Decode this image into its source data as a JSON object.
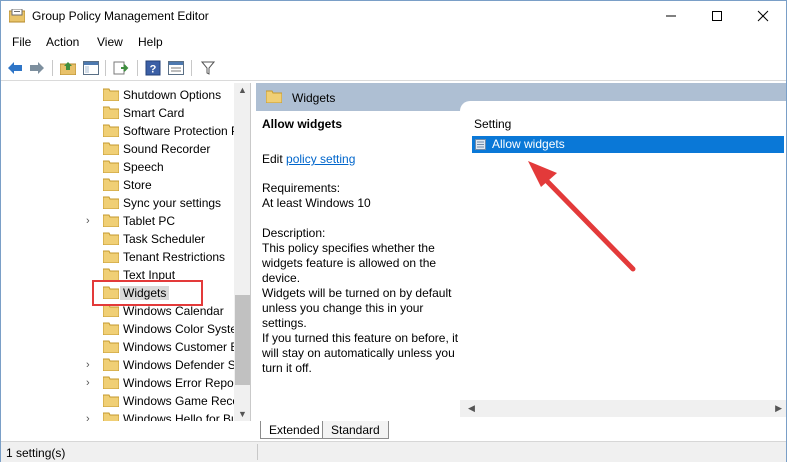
{
  "window": {
    "title": "Group Policy Management Editor",
    "controls": {
      "minimize": "—",
      "maximize": "☐",
      "close": "✕"
    }
  },
  "menu": {
    "items": [
      "File",
      "Action",
      "View",
      "Help"
    ]
  },
  "tree": {
    "items": [
      {
        "label": "Shutdown Options",
        "expandable": false
      },
      {
        "label": "Smart Card",
        "expandable": false
      },
      {
        "label": "Software Protection P",
        "expandable": false
      },
      {
        "label": "Sound Recorder",
        "expandable": false
      },
      {
        "label": "Speech",
        "expandable": false
      },
      {
        "label": "Store",
        "expandable": false
      },
      {
        "label": "Sync your settings",
        "expandable": false
      },
      {
        "label": "Tablet PC",
        "expandable": true
      },
      {
        "label": "Task Scheduler",
        "expandable": false
      },
      {
        "label": "Tenant Restrictions",
        "expandable": false
      },
      {
        "label": "Text Input",
        "expandable": false
      },
      {
        "label": "Widgets",
        "expandable": false,
        "selected": true
      },
      {
        "label": "Windows Calendar",
        "expandable": false
      },
      {
        "label": "Windows Color Syste",
        "expandable": false
      },
      {
        "label": "Windows Customer E",
        "expandable": false
      },
      {
        "label": "Windows Defender S",
        "expandable": true
      },
      {
        "label": "Windows Error Repor",
        "expandable": true
      },
      {
        "label": "Windows Game Reco",
        "expandable": false
      },
      {
        "label": "Windows Hello for Bu",
        "expandable": true
      }
    ]
  },
  "right_pane": {
    "header": "Widgets",
    "description": {
      "title": "Allow widgets",
      "edit_prefix": "Edit",
      "edit_link": "policy setting",
      "requirements_label": "Requirements:",
      "requirements_value": "At least Windows 10",
      "description_label": "Description:",
      "para1": "This policy specifies whether the widgets feature is allowed on the device.",
      "para2": "Widgets will be turned on by default unless you change this in your settings.",
      "para3": "If you turned this feature on before, it will stay on automatically unless you turn it off."
    },
    "list": {
      "column_header": "Setting",
      "rows": [
        {
          "label": "Allow widgets",
          "selected": true
        }
      ]
    }
  },
  "tabs": [
    "Extended",
    "Standard"
  ],
  "status": {
    "text": "1 setting(s)"
  },
  "colors": {
    "selection": "#0a78d7",
    "header_band": "#aebfd3",
    "annotation": "#e33a3a",
    "link": "#0066cc"
  }
}
